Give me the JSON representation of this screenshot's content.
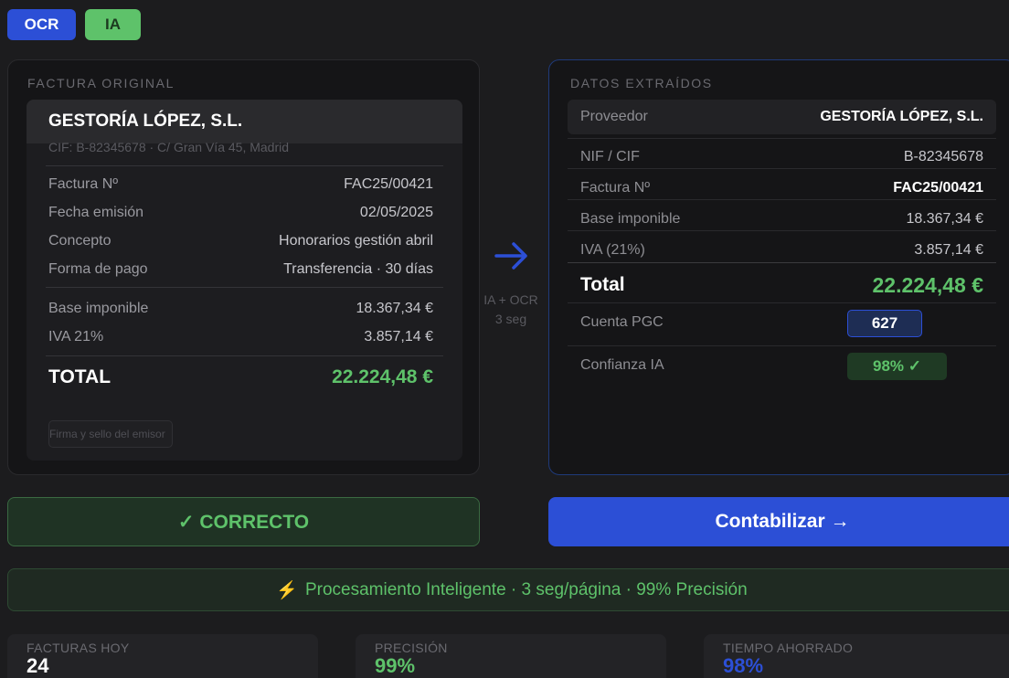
{
  "badges": {
    "ocr": "OCR",
    "ia": "IA"
  },
  "original": {
    "title": "FACTURA ORIGINAL",
    "company": "GESTORÍA LÓPEZ, S.L.",
    "cif_line": "CIF: B-82345678 · C/ Gran Vía 45, Madrid",
    "rows": [
      {
        "label": "Factura Nº",
        "value": "FAC25/00421"
      },
      {
        "label": "Fecha emisión",
        "value": "02/05/2025"
      },
      {
        "label": "Concepto",
        "value": "Honorarios gestión abril"
      },
      {
        "label": "Forma de pago",
        "value": "Transferencia · 30 días"
      },
      {
        "label": "Base imponible",
        "value": "18.367,34 €"
      },
      {
        "label": "IVA 21%",
        "value": "3.857,14 €"
      }
    ],
    "total_label": "TOTAL",
    "total_value": "22.224,48 €",
    "signature": "Firma y sello del emisor"
  },
  "process": {
    "line1": "IA + OCR",
    "line2": "3 seg"
  },
  "extracted": {
    "title": "DATOS EXTRAÍDOS",
    "provider_label": "Proveedor",
    "provider_value": "GESTORÍA LÓPEZ, S.L.",
    "rows": [
      {
        "label": "NIF / CIF",
        "value": "B-82345678"
      },
      {
        "label": "Factura Nº",
        "value": "FAC25/00421"
      },
      {
        "label": "Base imponible",
        "value": "18.367,34 €"
      },
      {
        "label": "IVA (21%)",
        "value": "3.857,14 €"
      }
    ],
    "total_label": "Total",
    "total_value": "22.224,48 €",
    "account_label": "Cuenta PGC",
    "account_value": "627",
    "confidence_label": "Confianza IA",
    "confidence_value": "98% ✓"
  },
  "actions": {
    "correct": "✓ CORRECTO",
    "post": "Contabilizar →"
  },
  "banner": {
    "icon": "⚡",
    "text": "Procesamiento Inteligente · 3 seg/página · 99% Precisión"
  },
  "stats": [
    {
      "label": "FACTURAS HOY",
      "value": "24"
    },
    {
      "label": "PRECISIÓN",
      "value": "99%"
    },
    {
      "label": "TIEMPO AHORRADO",
      "value": "98%"
    }
  ],
  "colors": {
    "accent_blue": "#2c4fd6",
    "accent_green": "#5ec26a",
    "background": "#1c1c1e"
  }
}
